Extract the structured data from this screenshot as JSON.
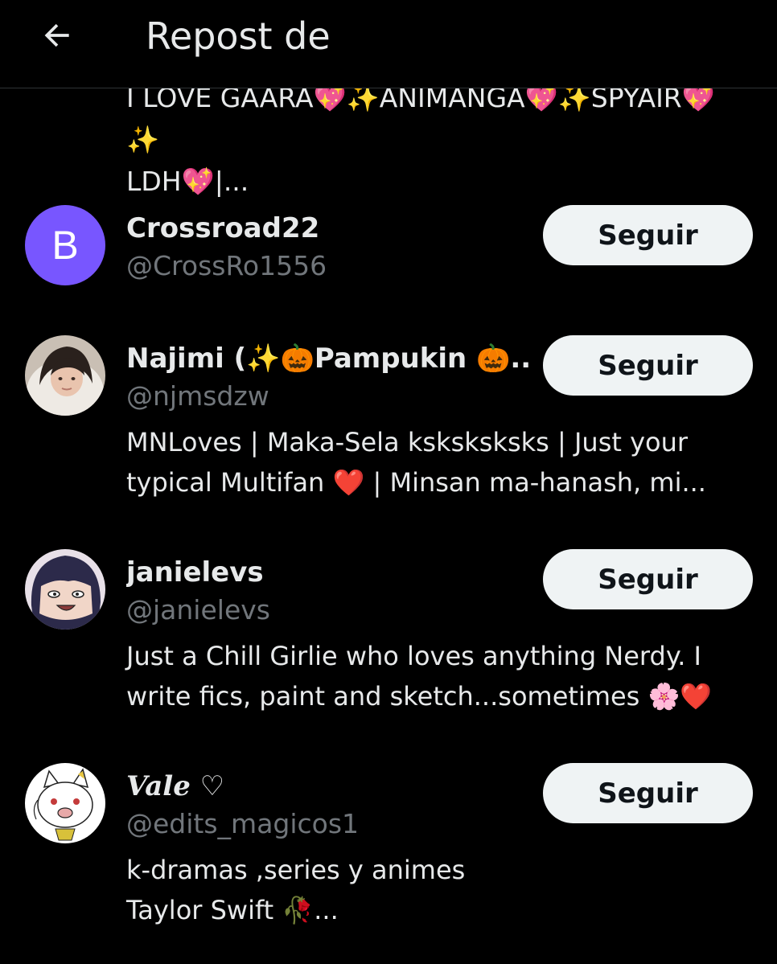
{
  "header": {
    "title": "Repost de"
  },
  "top_bio": {
    "line1": "I LOVE GAARA💖✨ANIMANGA💖✨SPYAIR💖✨",
    "line2": "LDH💖|..."
  },
  "users": [
    {
      "name": "Crossroad22",
      "handle": "@CrossRo1556",
      "avatar_letter": "B",
      "avatar_color": "#7856ff",
      "follow_label": "Seguir",
      "bio_lines": []
    },
    {
      "name": "Najimi (✨🎃Pampukin 🎃...",
      "handle": "@njmsdzw",
      "follow_label": "Seguir",
      "bio_lines": [
        "MNLoves | Maka-Sela ksksksksks |  Just your",
        "typical Multifan ❤️ | Minsan ma-hanash, mi..."
      ]
    },
    {
      "name": "janielevs",
      "handle": "@janielevs",
      "follow_label": "Seguir",
      "bio_lines": [
        "Just a Chill Girlie who loves anything Nerdy. I",
        "write fics, paint and sketch...sometimes 🌸❤️"
      ]
    },
    {
      "name": "Vale ♡",
      "handle": "@edits_magicos1",
      "follow_label": "Seguir",
      "bio_lines": [
        "k-dramas ,series y animes",
        "Taylor Swift 🥀..."
      ]
    }
  ],
  "colors": {
    "background": "#000000",
    "text": "#e7e9ea",
    "muted": "#71767b",
    "button_bg": "#eff3f4",
    "button_text": "#0f1419"
  }
}
